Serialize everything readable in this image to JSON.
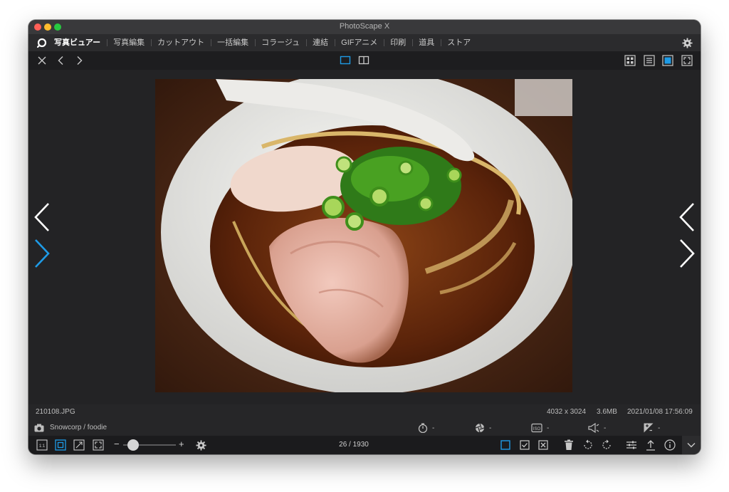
{
  "window": {
    "title": "PhotoScape X"
  },
  "menu": {
    "items": [
      {
        "label": "写真ビュアー",
        "active": true
      },
      {
        "label": "写真編集"
      },
      {
        "label": "カットアウト"
      },
      {
        "label": "一括編集"
      },
      {
        "label": "コラージュ"
      },
      {
        "label": "連結"
      },
      {
        "label": "GIFアニメ"
      },
      {
        "label": "印刷"
      },
      {
        "label": "道具"
      },
      {
        "label": "ストア"
      }
    ]
  },
  "toolbar": {
    "icons": [
      "close-icon",
      "back-icon",
      "forward-icon",
      "single-view-icon",
      "split-view-icon",
      "grid-view-icon",
      "list-view-icon",
      "single-image-view-icon",
      "fullscreen-icon"
    ]
  },
  "photo": {
    "subject": "ramen"
  },
  "info": {
    "filename": "210108.JPG",
    "dimensions": "4032 x 3024",
    "filesize": "3.6MB",
    "datetime": "2021/01/08 17:56:09"
  },
  "exif": {
    "camera": "Snowcorp / foodie",
    "shutter": "-",
    "aperture": "-",
    "iso": "-",
    "exposure": "-",
    "ev": "-"
  },
  "bottom": {
    "zoom_minus": "−",
    "zoom_plus": "+",
    "zoom_level": 0.1,
    "counter": "26 / 1930",
    "one_to_one": "1:1"
  },
  "colors": {
    "accent": "#1e9be6",
    "titlebar": "#39393b",
    "menubar": "#2b2b2d",
    "viewer_bg": "#232325"
  }
}
